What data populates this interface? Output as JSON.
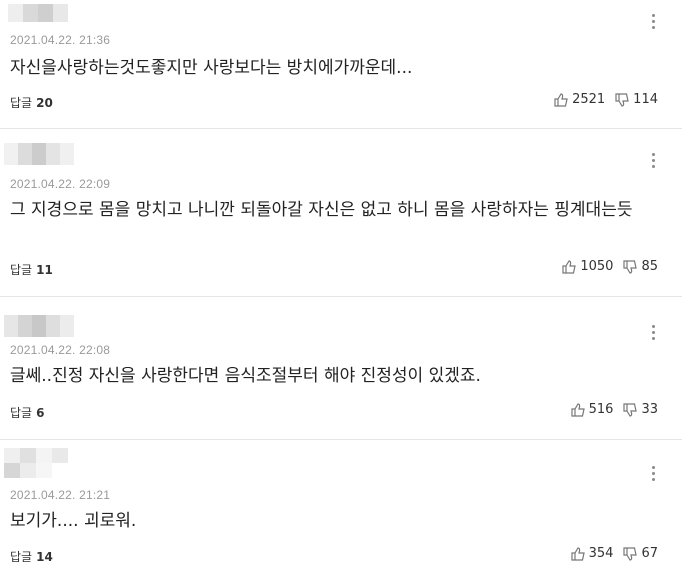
{
  "labels": {
    "reply": "답글"
  },
  "comments": [
    {
      "date": "2021.04.22. 21:36",
      "text": "자신을사랑하는것도좋지만 사랑보다는 방치에가까운데...",
      "replies": "20",
      "likes": "2521",
      "dislikes": "114"
    },
    {
      "date": "2021.04.22. 22:09",
      "text": "그 지경으로 몸을 망치고 나니깐 되돌아갈 자신은 없고 하니 몸을 사랑하자는 핑계대는듯",
      "replies": "11",
      "likes": "1050",
      "dislikes": "85"
    },
    {
      "date": "2021.04.22. 22:08",
      "text": "글쎄..진정 자신을 사랑한다면 음식조절부터 해야 진정성이 있겠죠.",
      "replies": "6",
      "likes": "516",
      "dislikes": "33"
    },
    {
      "date": "2021.04.22. 21:21",
      "text": "보기가.... 괴로워.",
      "replies": "14",
      "likes": "354",
      "dislikes": "67"
    }
  ]
}
